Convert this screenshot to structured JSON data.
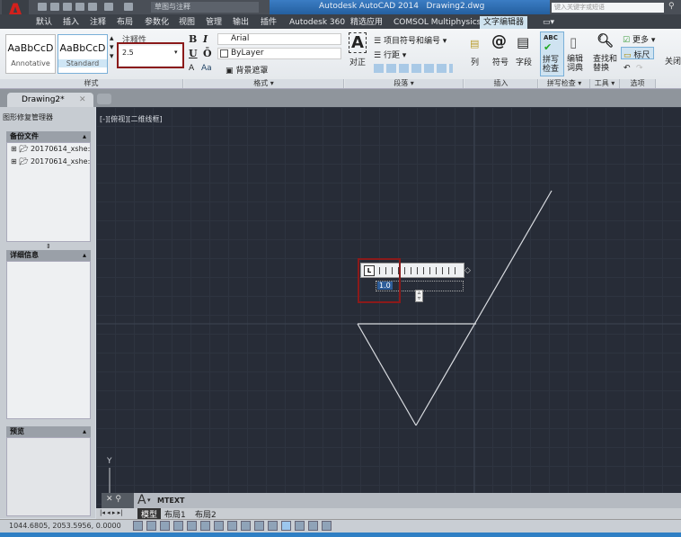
{
  "title": {
    "workspace": "草图与注释",
    "app": "Autodesk AutoCAD 2014",
    "file": "Drawing2.dwg",
    "search_placeholder": "键入关键字或短语"
  },
  "tabs": [
    "默认",
    "插入",
    "注释",
    "布局",
    "参数化",
    "视图",
    "管理",
    "输出",
    "插件",
    "Autodesk 360",
    "精选应用",
    "COMSOL Multiphysics",
    "文字编辑器"
  ],
  "active_tab": "文字编辑器",
  "ribbon": {
    "styles": {
      "s1": "AaBbCcD",
      "s1_label": "Annotative",
      "s2": "AaBbCcD",
      "s2_label": "Standard",
      "annotative": "注释性",
      "height_value": "2.5",
      "panel": "样式"
    },
    "format": {
      "bold": "B",
      "italic": "I",
      "underline": "U",
      "overline": "Ō",
      "font": "Arial",
      "color": "ByLayer",
      "bgmask": "背景遮罩",
      "case": "Aa",
      "panel": "格式 ▾"
    },
    "paragraph": {
      "justify": "对正",
      "bullets": "项目符号和编号 ▾",
      "spacing": "行距 ▾",
      "panel": "段落 ▾"
    },
    "insert": {
      "columns": "列",
      "symbol": "符号",
      "field": "字段",
      "panel": "插入"
    },
    "spell": {
      "check": "拼写\n检查",
      "dict": "编辑\n词典",
      "panel": "拼写检查 ▾"
    },
    "tools": {
      "find": "查找和\n替换",
      "panel": "工具 ▾"
    },
    "options": {
      "more": "更多 ▾",
      "ruler": "标尺",
      "panel": "选项"
    },
    "close": "关闭"
  },
  "doc_tab": "Drawing2*",
  "palette": {
    "title": "图形修复管理器",
    "backup": "备份文件",
    "files": [
      "20170614_xshe:",
      "20170614_xshe:"
    ],
    "details": "详细信息",
    "preview": "预览"
  },
  "viewport_label": "[-][俯视][二维线框]",
  "ruler": {
    "tab_icon": "L",
    "value": "1.0"
  },
  "ucs": {
    "y": "Y"
  },
  "command": {
    "text": "MTEXT"
  },
  "layout_tabs": [
    "模型",
    "布局1",
    "布局2"
  ],
  "status": {
    "coords": "1044.6805, 2053.5956, 0.0000"
  },
  "colors": {
    "canvas": "#272c37",
    "highlight": "#8b1a1a",
    "accent": "#2f7fc4"
  }
}
